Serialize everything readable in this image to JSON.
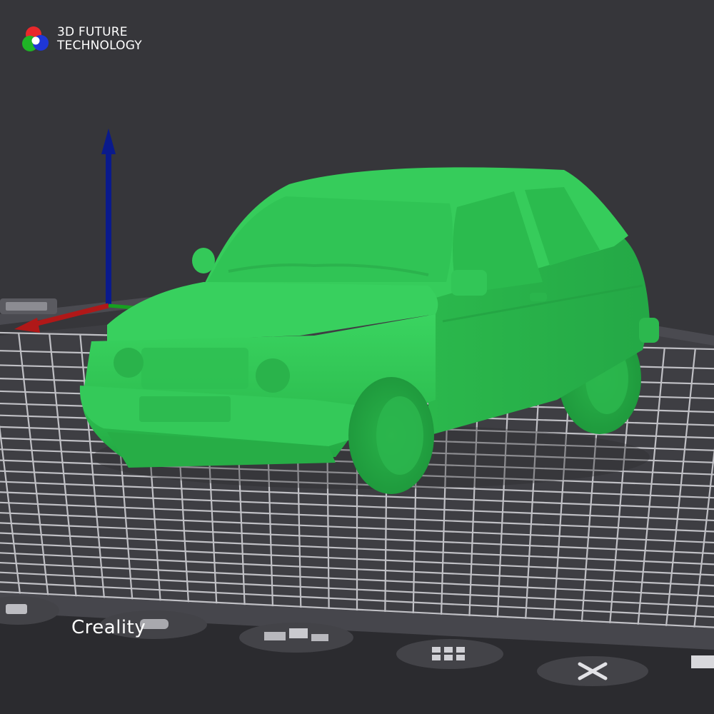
{
  "logo": {
    "line1": "3D FUTURE",
    "line2": "TECHNOLOGY",
    "icon": "tricolor-swirl-icon",
    "colors": [
      "#e8282b",
      "#1fb526",
      "#1e36d6"
    ]
  },
  "viewport": {
    "background": "#36363a",
    "model": "hatchback-car-3d-model",
    "model_color": "#33c556",
    "axes": {
      "z_color": "#0a1a8c",
      "x_color": "#b01818",
      "y_color": "#16a020"
    },
    "grid_color": "#cfcfd4",
    "bottom_toolbar_icons": [
      "layers-icon",
      "dots-icon",
      "cube-tray-icon",
      "grid-arrange-icon",
      "close-icon"
    ]
  },
  "brand": {
    "label": "Creality"
  }
}
